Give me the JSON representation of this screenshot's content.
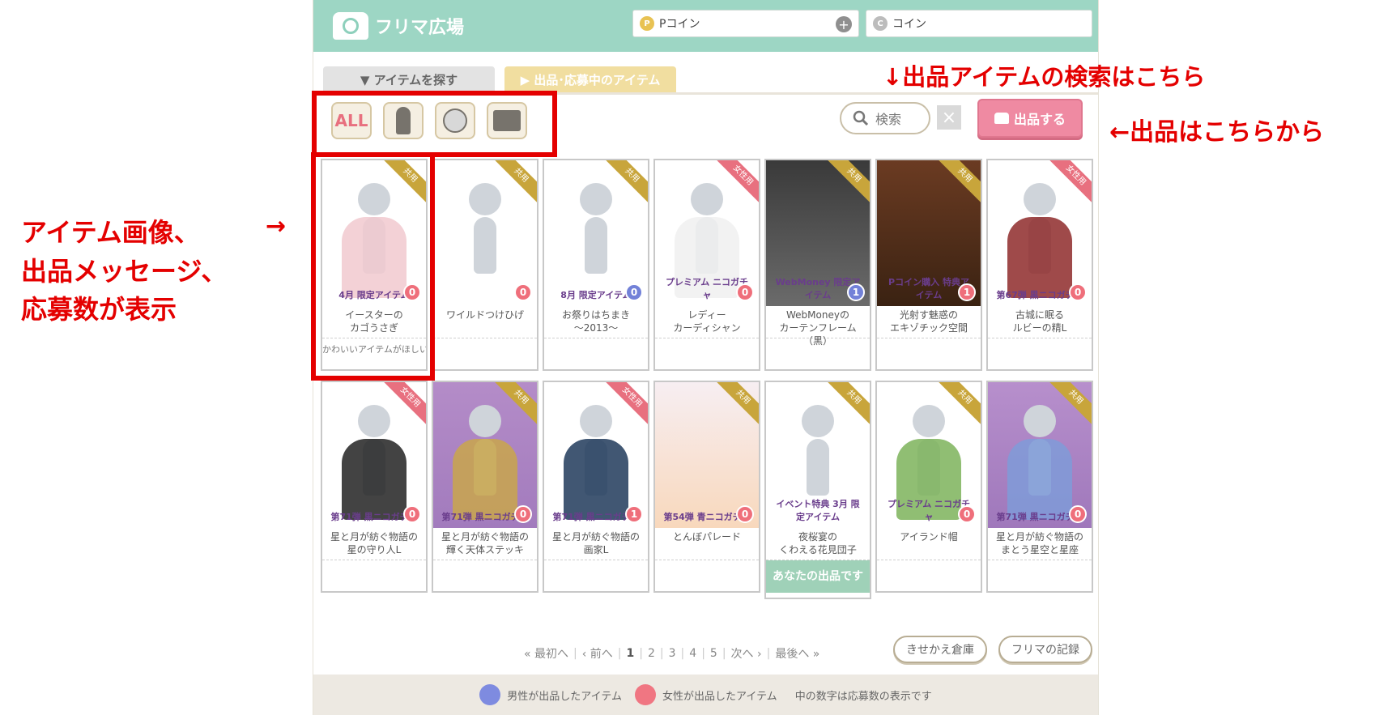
{
  "header": {
    "title": "フリマ広場",
    "pcoin_label": "Pコイン",
    "pcoin_icon": "P",
    "coin_label": "コイン",
    "coin_icon": "C",
    "plus": "+"
  },
  "tabs": [
    {
      "label": "▼ アイテムを探す"
    },
    {
      "label": "▶ 出品･応募中のアイテム"
    }
  ],
  "filters": {
    "all": "ALL",
    "search": "検索",
    "clear": "×",
    "post": "出品する"
  },
  "items": [
    {
      "name": "イースターの\nカゴうさぎ",
      "tag": "共用",
      "count": "0",
      "badge": "pink",
      "label": "4月 限定アイテム",
      "message": "かわいいアイテムがほしい"
    },
    {
      "name": "ワイルドつけひげ",
      "tag": "共用",
      "count": "0",
      "badge": "pink",
      "label": "",
      "message": ""
    },
    {
      "name": "お祭りはちまき\n～2013～",
      "tag": "共用",
      "count": "0",
      "badge": "blue",
      "label": "8月 限定アイテム",
      "message": ""
    },
    {
      "name": "レディー\nカーディシャン",
      "tag": "女性用",
      "count": "0",
      "badge": "pink",
      "label": "プレミアム ニコガチャ",
      "message": ""
    },
    {
      "name": "WebMoneyの\nカーテンフレーム（黒）",
      "tag": "共用",
      "count": "1",
      "badge": "blue",
      "label": "WebMoney 限定アイテム",
      "message": ""
    },
    {
      "name": "光射す魅惑の\nエキゾチック空間",
      "tag": "共用",
      "count": "1",
      "badge": "pink",
      "label": "Pコイン購入 特典アイテム",
      "message": ""
    },
    {
      "name": "古城に眠る\nルビーの精L",
      "tag": "女性用",
      "count": "0",
      "badge": "pink",
      "label": "第67弾 黒ニコガチャ",
      "message": ""
    },
    {
      "name": "星と月が紡ぐ物語の\n星の守り人L",
      "tag": "女性用",
      "count": "0",
      "badge": "pink",
      "label": "第71弾 黒ニコガチャ",
      "message": ""
    },
    {
      "name": "星と月が紡ぐ物語の\n輝く天体ステッキ",
      "tag": "共用",
      "count": "0",
      "badge": "pink",
      "label": "第71弾 黒ニコガチャ",
      "message": ""
    },
    {
      "name": "星と月が紡ぐ物語の\n画家L",
      "tag": "女性用",
      "count": "1",
      "badge": "pink",
      "label": "第71弾 黒ニコガチャ",
      "message": ""
    },
    {
      "name": "とんぼパレード",
      "tag": "共用",
      "count": "0",
      "badge": "pink",
      "label": "第54弾 青ニコガチャ",
      "message": ""
    },
    {
      "name": "夜桜宴の\nくわえる花見団子",
      "tag": "共用",
      "count": "",
      "badge": "",
      "label": "イベント特典 3月 限定アイテム",
      "message": "",
      "mine": "あなたの出品です"
    },
    {
      "name": "アイランド帽",
      "tag": "共用",
      "count": "0",
      "badge": "pink",
      "label": "プレミアム ニコガチャ",
      "message": ""
    },
    {
      "name": "星と月が紡ぐ物語の\nまとう星空と星座",
      "tag": "共用",
      "count": "0",
      "badge": "pink",
      "label": "第71弾 黒ニコガチャ",
      "message": ""
    }
  ],
  "pager": {
    "first": "« 最初へ",
    "prev": "‹ 前へ",
    "pages": [
      "1",
      "2",
      "3",
      "4",
      "5"
    ],
    "next": "次へ ›",
    "last": "最後へ »"
  },
  "buttons": {
    "wardrobe": "きせかえ倉庫",
    "record": "フリマの記録"
  },
  "legend": {
    "male": "男性が出品したアイテム",
    "female": "女性が出品したアイテム",
    "note": "中の数字は応募数の表示です"
  },
  "annotations": {
    "search_hint": "↓出品アイテムの検索はこちら",
    "post_hint": "←出品はこちらから",
    "item_hint_1": "アイテム画像、",
    "item_hint_arrow": "→",
    "item_hint_2": "出品メッセージ、",
    "item_hint_3": "応募数が表示"
  },
  "colors": {
    "header": "#9dd6c4",
    "annotation": "#e40000",
    "male": "#7281d8",
    "female": "#ef6f7b"
  }
}
